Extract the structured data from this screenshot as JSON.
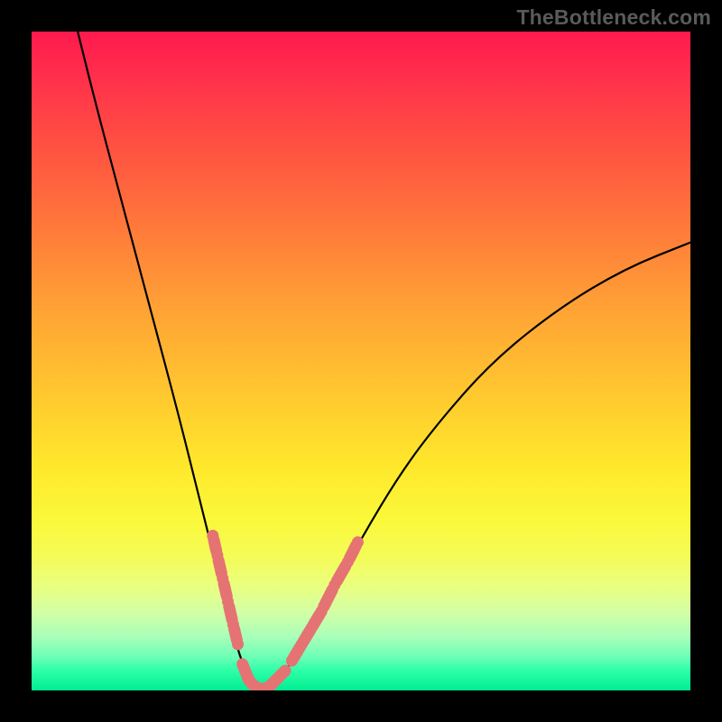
{
  "watermark": "TheBottleneck.com",
  "colors": {
    "curve": "#000000",
    "marker": "#e57373",
    "frame": "#000000"
  },
  "chart_data": {
    "type": "line",
    "title": "",
    "xlabel": "",
    "ylabel": "",
    "xlim": [
      0,
      100
    ],
    "ylim": [
      0,
      100
    ],
    "grid": false,
    "series": [
      {
        "name": "bottleneck-curve",
        "x": [
          7,
          10,
          14,
          18,
          22,
          25,
          27,
          29,
          30.5,
          32,
          33.5,
          35,
          37,
          40,
          44,
          50,
          56,
          62,
          70,
          80,
          90,
          100
        ],
        "y": [
          100,
          88,
          73,
          58,
          43,
          31,
          23,
          15,
          9,
          4,
          1,
          0,
          1,
          5,
          12,
          23,
          33,
          41,
          50,
          58,
          64,
          68
        ]
      }
    ],
    "marked_segments": {
      "left_arm": [
        {
          "x": 27.5,
          "y": 23.5
        },
        {
          "x": 28.2,
          "y": 20.5
        },
        {
          "x": 29.0,
          "y": 17.0
        },
        {
          "x": 29.8,
          "y": 13.5
        },
        {
          "x": 30.6,
          "y": 10.0
        },
        {
          "x": 31.3,
          "y": 7.0
        }
      ],
      "bottom": [
        {
          "x": 32.0,
          "y": 4.0
        },
        {
          "x": 33.0,
          "y": 1.5
        },
        {
          "x": 34.0,
          "y": 0.5
        },
        {
          "x": 35.0,
          "y": 0.2
        },
        {
          "x": 36.0,
          "y": 0.5
        },
        {
          "x": 37.0,
          "y": 1.5
        },
        {
          "x": 38.5,
          "y": 3.0
        }
      ],
      "right_arm": [
        {
          "x": 39.5,
          "y": 4.5
        },
        {
          "x": 41.0,
          "y": 7.0
        },
        {
          "x": 42.5,
          "y": 9.5
        },
        {
          "x": 44.0,
          "y": 12.0
        },
        {
          "x": 46.0,
          "y": 16.0
        },
        {
          "x": 48.0,
          "y": 19.5
        },
        {
          "x": 49.5,
          "y": 22.5
        }
      ]
    },
    "annotations": []
  }
}
